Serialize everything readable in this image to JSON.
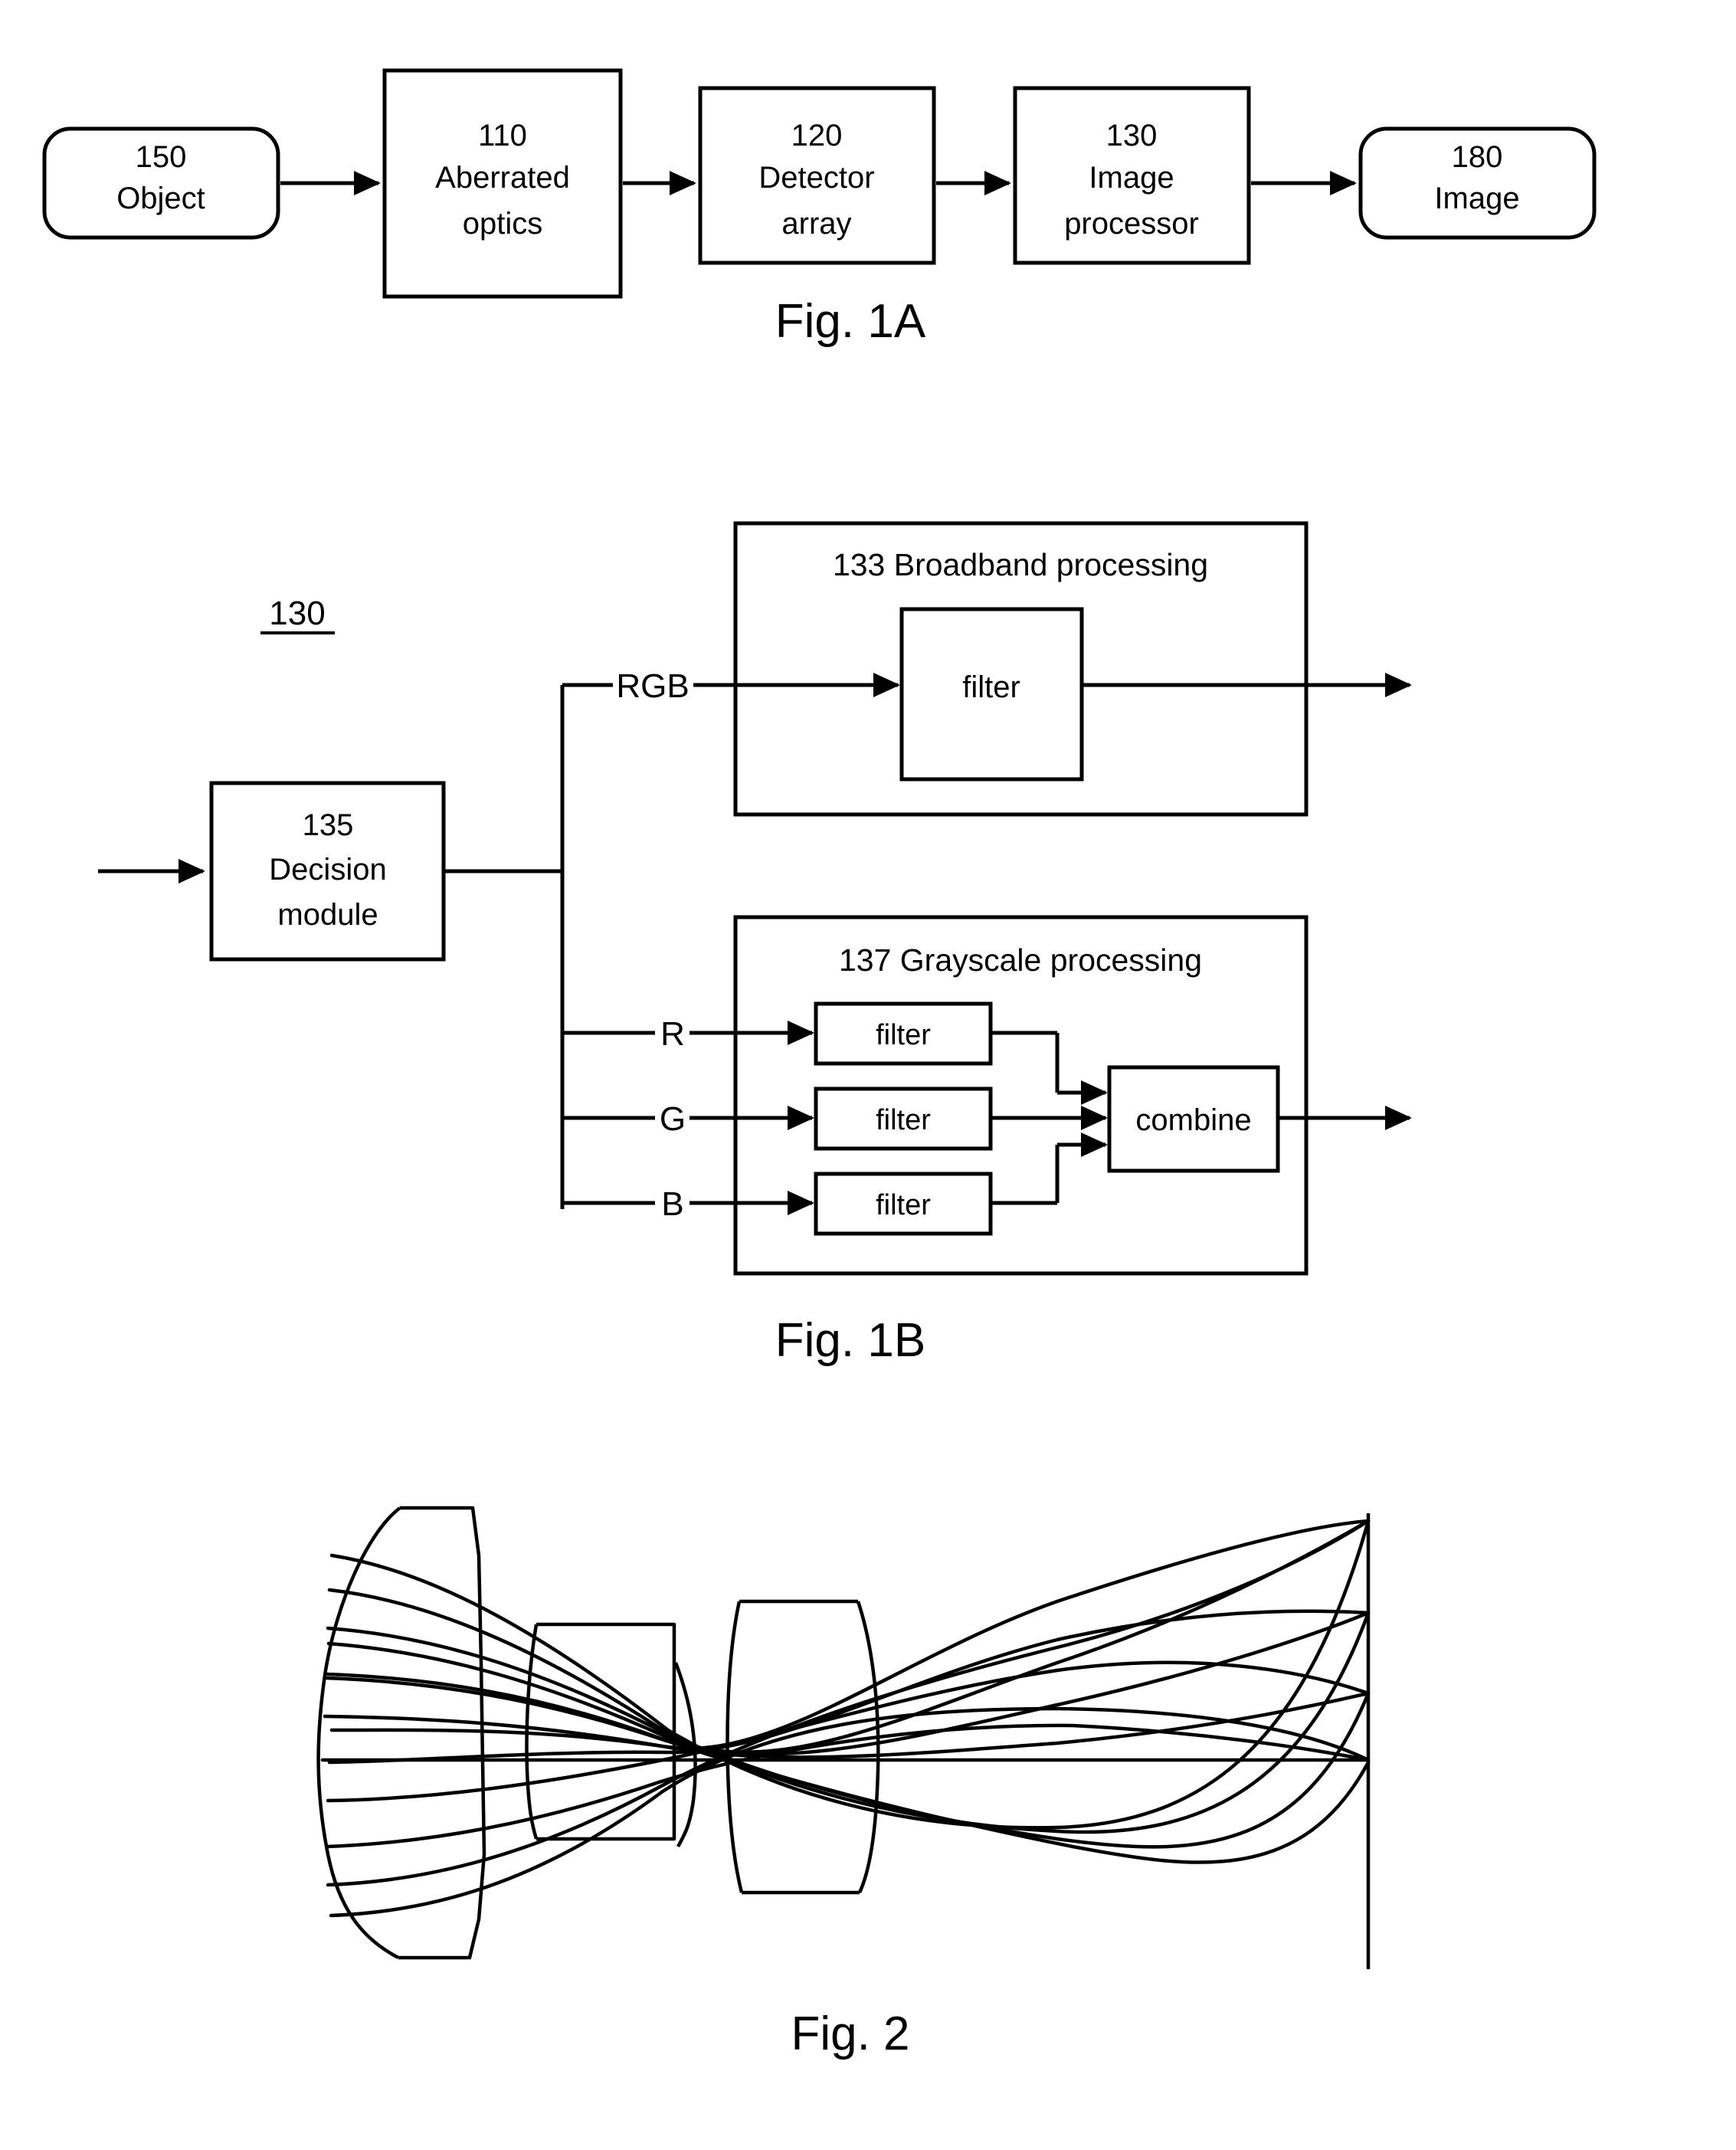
{
  "figures": [
    {
      "id": "fig1a",
      "caption": "Fig. 1A",
      "nodes": [
        {
          "id": "object",
          "shape": "rounded",
          "line1": "150",
          "line2": "Object"
        },
        {
          "id": "aberrated",
          "shape": "rect",
          "line1": "110",
          "line2": "Aberrated",
          "line3": "optics"
        },
        {
          "id": "detector",
          "shape": "rect",
          "line1": "120",
          "line2": "Detector",
          "line3": "array"
        },
        {
          "id": "processor",
          "shape": "rect",
          "line1": "130",
          "line2": "Image",
          "line3": "processor"
        },
        {
          "id": "image",
          "shape": "rounded",
          "line1": "180",
          "line2": "Image"
        }
      ]
    },
    {
      "id": "fig1b",
      "caption": "Fig. 1B",
      "ref_label": "130",
      "decision": {
        "line1": "135",
        "line2": "Decision",
        "line3": "module"
      },
      "broadband": {
        "title": "133 Broadband processing",
        "filter": "filter"
      },
      "grayscale": {
        "title": "137 Grayscale processing",
        "filters": [
          "filter",
          "filter",
          "filter"
        ],
        "combine": "combine"
      },
      "signals": {
        "broadband": "RGB",
        "channels": [
          "R",
          "G",
          "B"
        ]
      }
    },
    {
      "id": "fig2",
      "caption": "Fig. 2"
    }
  ],
  "colors": {
    "ink": "#000000",
    "paper": "#ffffff"
  }
}
